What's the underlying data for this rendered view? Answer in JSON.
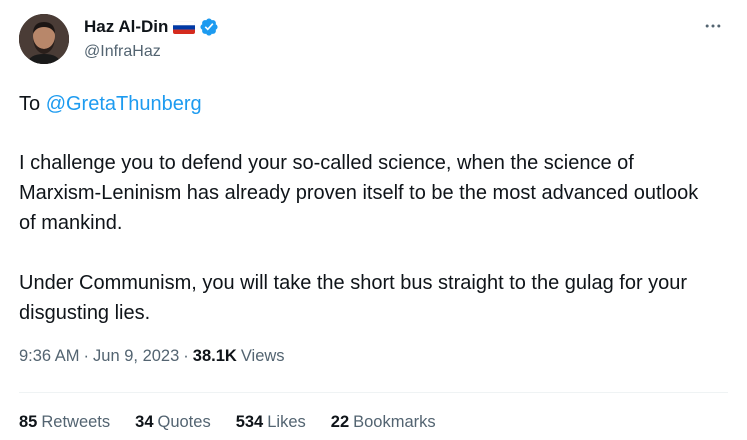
{
  "author": {
    "display_name": "Haz Al-Din",
    "handle": "@InfraHaz",
    "flag_icon": "russia-flag-icon",
    "verified_icon": "verified-badge-icon",
    "verified_color": "#1d9bf0"
  },
  "tweet": {
    "line1_prefix": "To ",
    "mention": "@GretaThunberg",
    "paragraph2": "I challenge you to defend your so-called science, when the science of Marxism-Leninism has already proven itself to be the most advanced outlook of mankind.",
    "paragraph3": "Under Communism, you will take the short bus straight to the gulag for your disgusting lies."
  },
  "meta": {
    "time": "9:36 AM",
    "separator": "·",
    "date": "Jun 9, 2023",
    "views_count": "38.1K",
    "views_label": "Views"
  },
  "stats": {
    "retweets_count": "85",
    "retweets_label": "Retweets",
    "quotes_count": "34",
    "quotes_label": "Quotes",
    "likes_count": "534",
    "likes_label": "Likes",
    "bookmarks_count": "22",
    "bookmarks_label": "Bookmarks"
  },
  "colors": {
    "text": "#0f1419",
    "secondary": "#536471",
    "link": "#1d9bf0",
    "divider": "#eff3f4"
  }
}
